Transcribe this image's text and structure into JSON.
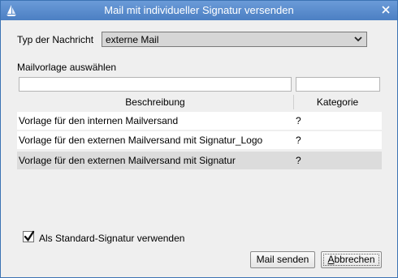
{
  "window": {
    "title": "Mail mit individueller Signatur versenden",
    "icon": "sailboat-icon",
    "close_icon": "close-icon",
    "accent_color": "#4b7fc3"
  },
  "message_type": {
    "label": "Typ der Nachricht",
    "selected": "externe Mail"
  },
  "template_section": {
    "label": "Mailvorlage auswählen",
    "columns": [
      "Beschreibung",
      "Kategorie"
    ],
    "rows": [
      {
        "beschreibung": "Vorlage für den internen Mailversand",
        "kategorie": "?"
      },
      {
        "beschreibung": "Vorlage für den externen Mailversand mit Signatur_Logo",
        "kategorie": "?"
      },
      {
        "beschreibung": "Vorlage für den externen Mailversand mit Signatur",
        "kategorie": "?"
      }
    ],
    "selected_row_index": 2
  },
  "default_signature": {
    "label": "Als Standard-Signatur verwenden",
    "checked": true
  },
  "buttons": {
    "send": "Mail senden",
    "cancel_accel": "A",
    "cancel_rest": "bbrechen"
  }
}
